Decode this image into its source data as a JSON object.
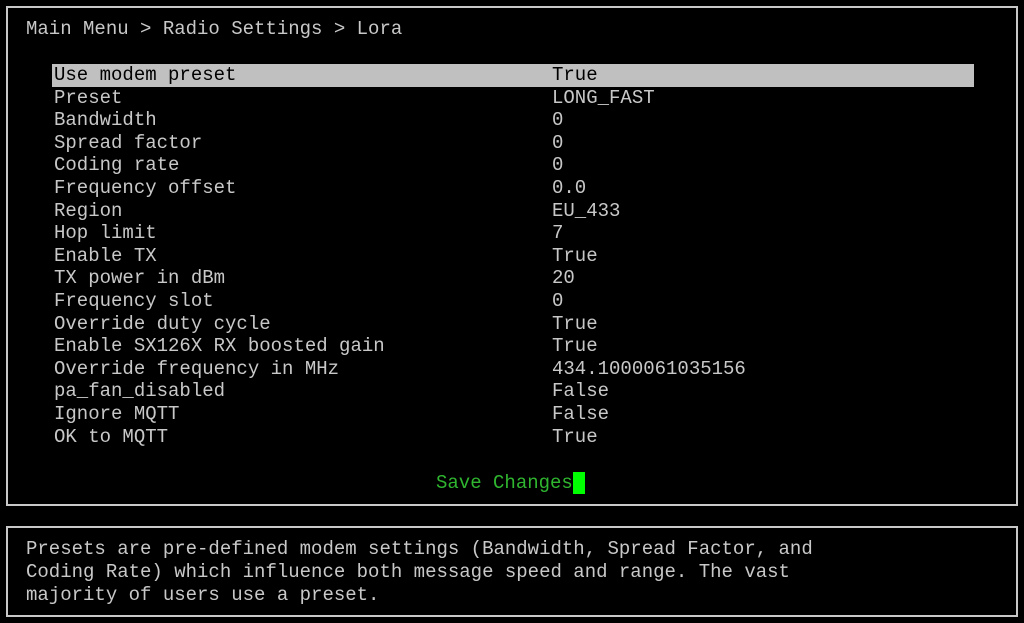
{
  "breadcrumb": "Main Menu > Radio Settings > Lora",
  "settings": [
    {
      "label": "Use modem preset",
      "value": "True"
    },
    {
      "label": "Preset",
      "value": "LONG_FAST"
    },
    {
      "label": "Bandwidth",
      "value": "0"
    },
    {
      "label": "Spread factor",
      "value": "0"
    },
    {
      "label": "Coding rate",
      "value": "0"
    },
    {
      "label": "Frequency offset",
      "value": "0.0"
    },
    {
      "label": "Region",
      "value": "EU_433"
    },
    {
      "label": "Hop limit",
      "value": "7"
    },
    {
      "label": "Enable TX",
      "value": "True"
    },
    {
      "label": "TX power in dBm",
      "value": "20"
    },
    {
      "label": "Frequency slot",
      "value": "0"
    },
    {
      "label": "Override duty cycle",
      "value": "True"
    },
    {
      "label": "Enable SX126X RX boosted gain",
      "value": "True"
    },
    {
      "label": "Override frequency in MHz",
      "value": "434.1000061035156"
    },
    {
      "label": "pa_fan_disabled",
      "value": "False"
    },
    {
      "label": "Ignore MQTT",
      "value": "False"
    },
    {
      "label": "OK to MQTT",
      "value": "True"
    }
  ],
  "save_label": "Save Changes",
  "help_text": "Presets are pre-defined modem settings (Bandwidth, Spread Factor, and\nCoding Rate) which influence both message speed and range. The vast\nmajority of users use a preset.",
  "colors": {
    "foreground": "#c8c8c8",
    "selection_bg": "#c0c0c0",
    "save_green": "#2fb52f",
    "cursor_green": "#00ff00"
  }
}
